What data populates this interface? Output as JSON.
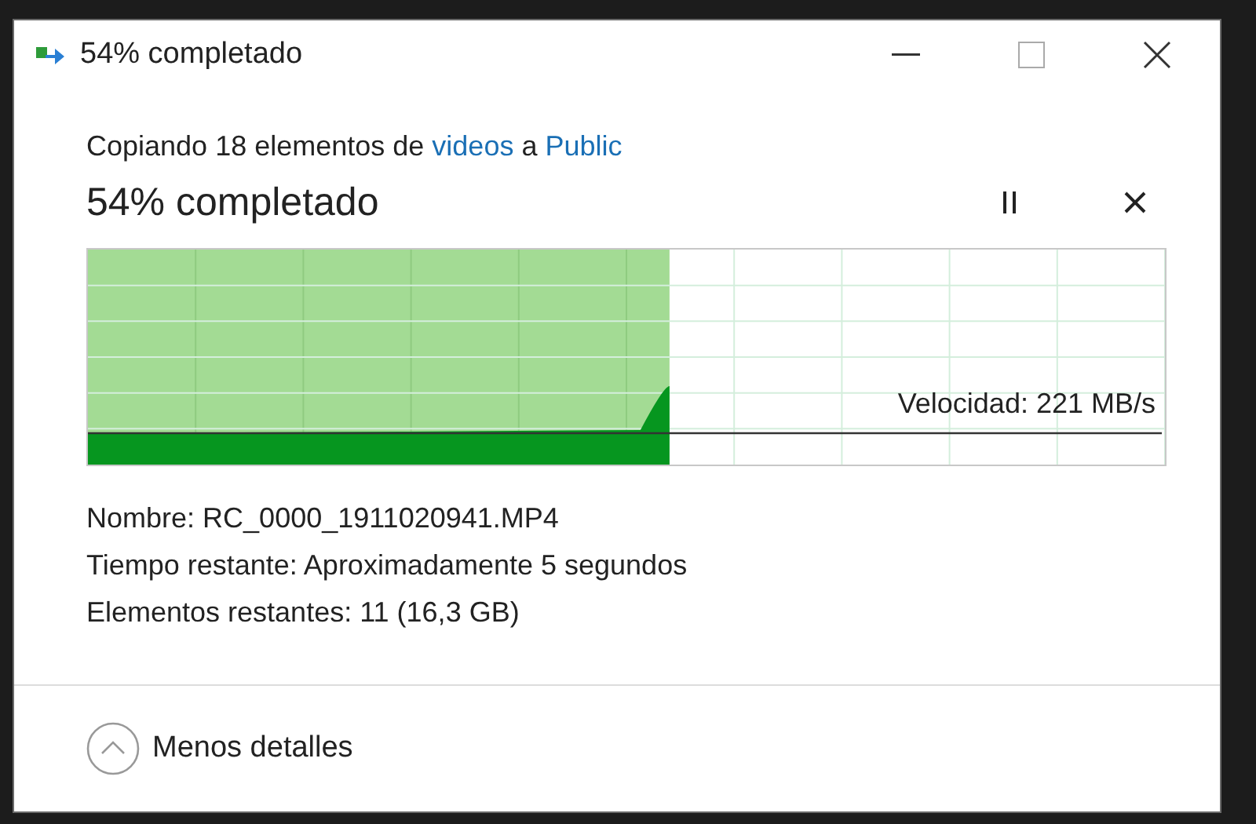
{
  "window": {
    "title": "54% completado"
  },
  "summary": {
    "prefix": "Copiando 18 elementos de ",
    "source": "videos",
    "middle": " a ",
    "destination": "Public"
  },
  "progress": {
    "heading": "54% completado",
    "level": 0.54,
    "speed": "Velocidad: 221 MB/s"
  },
  "details": [
    {
      "label": "Nombre:",
      "value": "RC_0000_1911020941.MP4"
    },
    {
      "label": "Tiempo restante:",
      "value": "Aproximadamente 5 segundos"
    },
    {
      "label": "Elementos restantes:",
      "value": "11 (16,3 GB)"
    }
  ],
  "footer": {
    "toggle": "Menos detalles",
    "expanded": true
  }
}
